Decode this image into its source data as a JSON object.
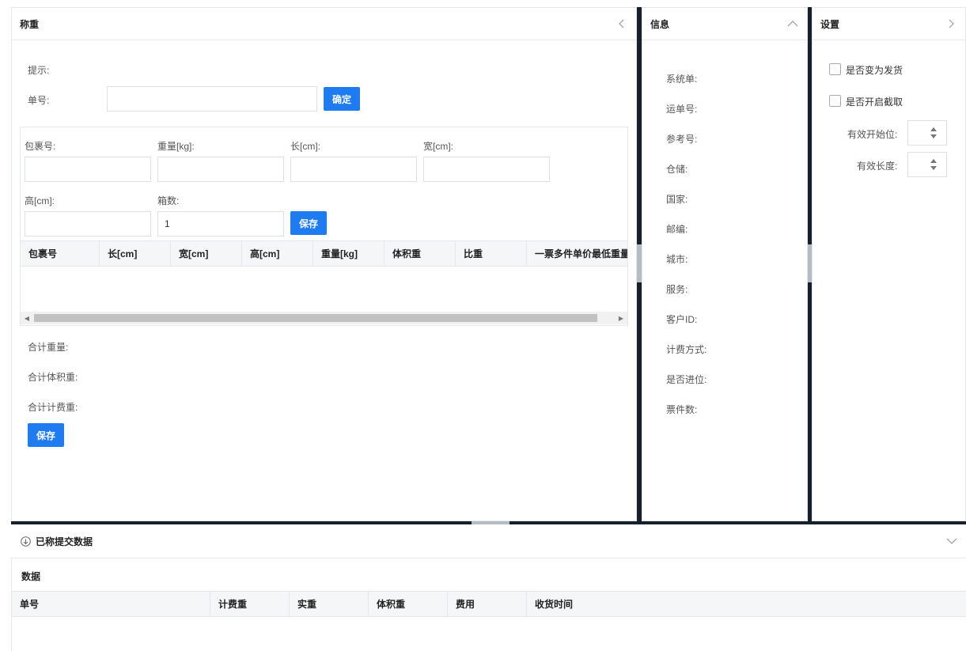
{
  "weigh_panel": {
    "title": "称重",
    "hint_label": "提示:",
    "order_label": "单号:",
    "order_value": "",
    "confirm_label": "确定",
    "fields": {
      "package_no": "包裹号:",
      "weight": "重量[kg]:",
      "length": "长[cm]:",
      "width": "宽[cm]:",
      "height": "高[cm]:",
      "box_count": "箱数:",
      "box_count_value": "1"
    },
    "save_row_label": "保存",
    "table_columns": [
      "包裹号",
      "长[cm]",
      "宽[cm]",
      "高[cm]",
      "重量[kg]",
      "体积重",
      "比重",
      "一票多件单价最低重量"
    ],
    "total_weight": "合计重量:",
    "total_volume_weight": "合计体积重:",
    "total_charge_weight": "合计计费重:",
    "save_label": "保存"
  },
  "info_panel": {
    "title": "信息",
    "items": [
      "系统单:",
      "运单号:",
      "参考号:",
      "仓储:",
      "国家:",
      "邮编:",
      "城市:",
      "服务:",
      "客户ID:",
      "计费方式:",
      "是否进位:",
      "票件数:"
    ]
  },
  "settings_panel": {
    "title": "设置",
    "checkbox_ship": "是否变为发货",
    "checkbox_intercept": "是否开启截取",
    "start_pos_label": "有效开始位:",
    "length_label": "有效长度:"
  },
  "submitted": {
    "title": "已称提交数据",
    "section_title": "数据",
    "columns": [
      "单号",
      "计费重",
      "实重",
      "体积重",
      "费用",
      "收货时间"
    ]
  }
}
